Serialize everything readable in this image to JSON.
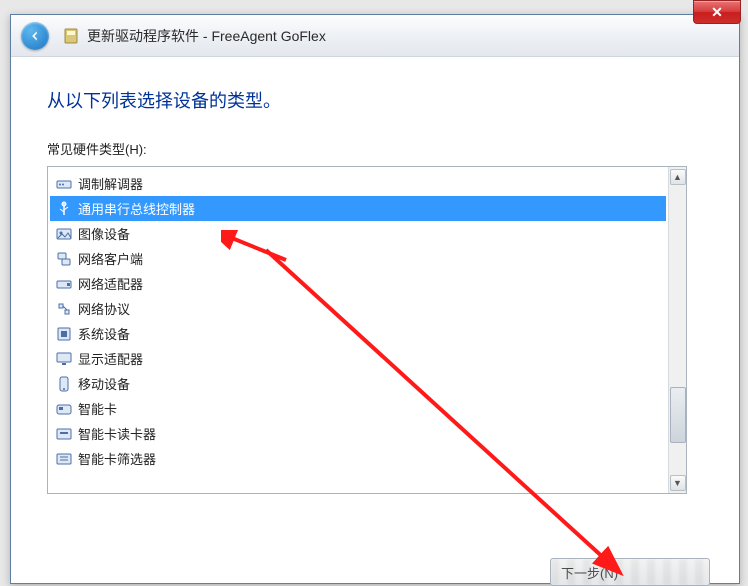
{
  "window": {
    "title": "更新驱动程序软件 - FreeAgent GoFlex"
  },
  "heading": "从以下列表选择设备的类型。",
  "list_label": "常见硬件类型(H):",
  "selected_index": 1,
  "hardware_types": [
    {
      "label": "调制解调器",
      "icon": "modem"
    },
    {
      "label": "通用串行总线控制器",
      "icon": "usb"
    },
    {
      "label": "图像设备",
      "icon": "image"
    },
    {
      "label": "网络客户端",
      "icon": "netclient"
    },
    {
      "label": "网络适配器",
      "icon": "netadapter"
    },
    {
      "label": "网络协议",
      "icon": "netproto"
    },
    {
      "label": "系统设备",
      "icon": "system"
    },
    {
      "label": "显示适配器",
      "icon": "display"
    },
    {
      "label": "移动设备",
      "icon": "mobile"
    },
    {
      "label": "智能卡",
      "icon": "smartcard"
    },
    {
      "label": "智能卡读卡器",
      "icon": "smartcardreader"
    },
    {
      "label": "智能卡筛选器",
      "icon": "smartcardfilter"
    }
  ],
  "buttons": {
    "next": "下一步(N)"
  }
}
